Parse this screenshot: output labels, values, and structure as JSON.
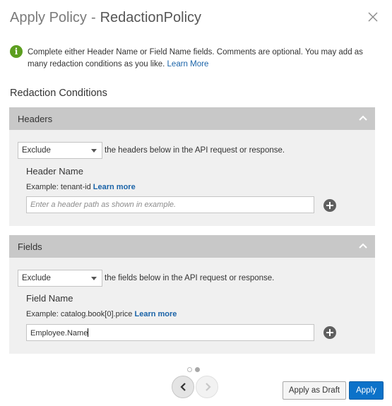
{
  "dialog": {
    "title": "Apply Policy",
    "title_separator": "-",
    "subtitle": "RedactionPolicy"
  },
  "info": {
    "text": "Complete either Header Name or Field Name fields. Comments are optional. You may add as many redaction conditions as you like.",
    "link": "Learn More"
  },
  "section_title": "Redaction Conditions",
  "headers_panel": {
    "title": "Headers",
    "select_value": "Exclude",
    "select_suffix": "the headers below in the API request or response.",
    "field_label": "Header Name",
    "example_text": "Example: tenant-id",
    "example_link": "Learn more",
    "input_placeholder": "Enter a header path as shown in example.",
    "input_value": ""
  },
  "fields_panel": {
    "title": "Fields",
    "select_value": "Exclude",
    "select_suffix": "the fields below in the API request or response.",
    "field_label": "Field Name",
    "example_text": "Example: catalog.book[0].price",
    "example_link": "Learn more",
    "input_value": "Employee.Name"
  },
  "pager": {
    "current_page": 2,
    "total_pages": 2
  },
  "footer": {
    "draft_label": "Apply as Draft",
    "apply_label": "Apply"
  },
  "icons": {
    "close": "close-icon",
    "info": "info-icon",
    "collapse": "chevron-up-icon",
    "add": "plus-circle-icon",
    "prev": "chevron-left-icon",
    "next": "chevron-right-icon"
  },
  "colors": {
    "accent": "#0c72c9",
    "info_green": "#5c9e1f",
    "link": "#1a63a8",
    "panel_header": "#c8c8c8",
    "panel_body": "#f0f0f0"
  }
}
